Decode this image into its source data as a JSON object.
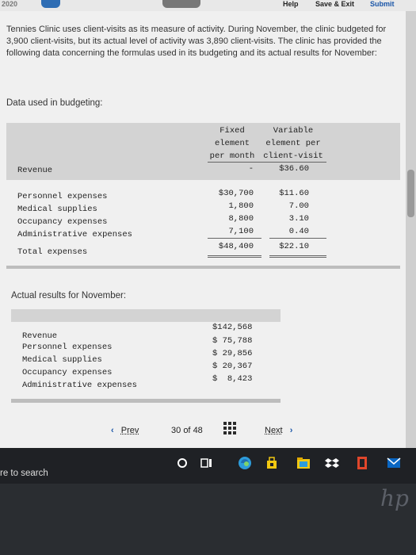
{
  "header": {
    "help": "Help",
    "save_exit": "Save & Exit",
    "submit": "Submit",
    "partial_left": "2020"
  },
  "intro_text": "Tennies Clinic uses client-visits as its measure of activity. During November, the clinic budgeted for 3,900 client-visits, but its actual level of activity was 3,890 client-visits. The clinic has provided the following data concerning the formulas used in its budgeting and its actual results for November:",
  "budget": {
    "title": "Data used in budgeting:",
    "col_fixed_1": "Fixed",
    "col_fixed_2": "element",
    "col_fixed_3": "per month",
    "col_var_1": "Variable",
    "col_var_2": "element per",
    "col_var_3": "client-visit",
    "rows": [
      {
        "label": "Revenue",
        "fixed": "-",
        "variable": "$36.60"
      },
      {
        "label": "Personnel expenses",
        "fixed": "$30,700",
        "variable": "$11.60"
      },
      {
        "label": "Medical supplies",
        "fixed": "1,800",
        "variable": "7.00"
      },
      {
        "label": "Occupancy expenses",
        "fixed": "8,800",
        "variable": "3.10"
      },
      {
        "label": "Administrative expenses",
        "fixed": "7,100",
        "variable": "0.40"
      },
      {
        "label": "Total expenses",
        "fixed": "$48,400",
        "variable": "$22.10"
      }
    ]
  },
  "actual": {
    "title": "Actual results for November:",
    "rows": [
      {
        "label": "Revenue",
        "value": "$142,568"
      },
      {
        "label": "Personnel expenses",
        "value": "$ 75,788"
      },
      {
        "label": "Medical supplies",
        "value": "$ 29,856"
      },
      {
        "label": "Occupancy expenses",
        "value": "$ 20,367"
      },
      {
        "label": "Administrative expenses",
        "value": "$  8,423"
      }
    ]
  },
  "pager": {
    "prev": "Prev",
    "current": "30",
    "of": "of",
    "total": "48",
    "next": "Next"
  },
  "taskbar": {
    "search_text": "re to search"
  },
  "brand": "hp"
}
